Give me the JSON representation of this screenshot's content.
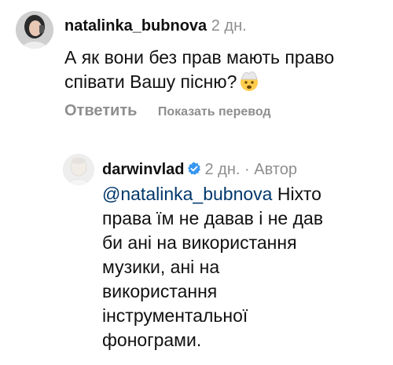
{
  "comment1": {
    "username": "natalinka_bubnova",
    "time": "2 дн.",
    "text": "А як вони без прав мають право співати Вашу пісню?",
    "emoji": "exploding-head-emoji",
    "reply_label": "Ответить",
    "translate_label": "Показать перевод"
  },
  "comment2": {
    "username": "darwinvlad",
    "verified_icon": "verified-badge-icon",
    "time": "2 дн.",
    "separator": "·",
    "author_label": "Автор",
    "mention": "@natalinka_bubnova",
    "text": "Ніхто права їм не давав і не дав би ані на використання музики, ані на використання інструментальної фонограми."
  },
  "colors": {
    "meta_gray": "#8e8e8e",
    "mention_blue": "#00376b",
    "verified_blue": "#3897f0",
    "text": "#111111"
  }
}
